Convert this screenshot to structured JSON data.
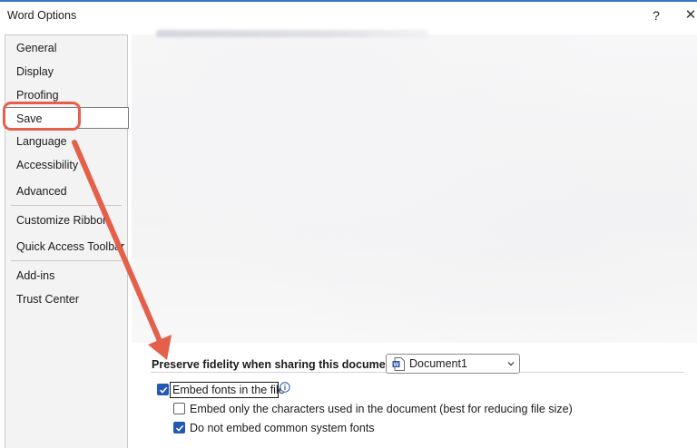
{
  "window": {
    "title": "Word Options",
    "help_glyph": "?",
    "close_glyph": "✕"
  },
  "sidebar": {
    "items": [
      {
        "label": "General"
      },
      {
        "label": "Display"
      },
      {
        "label": "Proofing"
      },
      {
        "label": "Save",
        "selected": true
      },
      {
        "label": "Language"
      },
      {
        "label": "Accessibility"
      },
      {
        "label": "Advanced"
      },
      {
        "label": "Customize Ribbon"
      },
      {
        "label": "Quick Access Toolbar"
      },
      {
        "label": "Add-ins"
      },
      {
        "label": "Trust Center"
      }
    ]
  },
  "fidelity": {
    "label": "Preserve fidelity when sharing this document:",
    "document_value": "Document1"
  },
  "options": {
    "embed_fonts": {
      "label": "Embed fonts in the file",
      "checked": true
    },
    "embed_only_used": {
      "label": "Embed only the characters used in the document (best for reducing file size)",
      "checked": false
    },
    "no_common_fonts": {
      "label": "Do not embed common system fonts",
      "checked": true
    }
  },
  "colors": {
    "annotation": "#e4604a",
    "checkbox_accent": "#2359b5",
    "title_border": "#3b78c4"
  },
  "icons": [
    "help-icon",
    "close-icon",
    "word-document-icon",
    "chevron-down-icon",
    "info-icon",
    "check-icon"
  ]
}
